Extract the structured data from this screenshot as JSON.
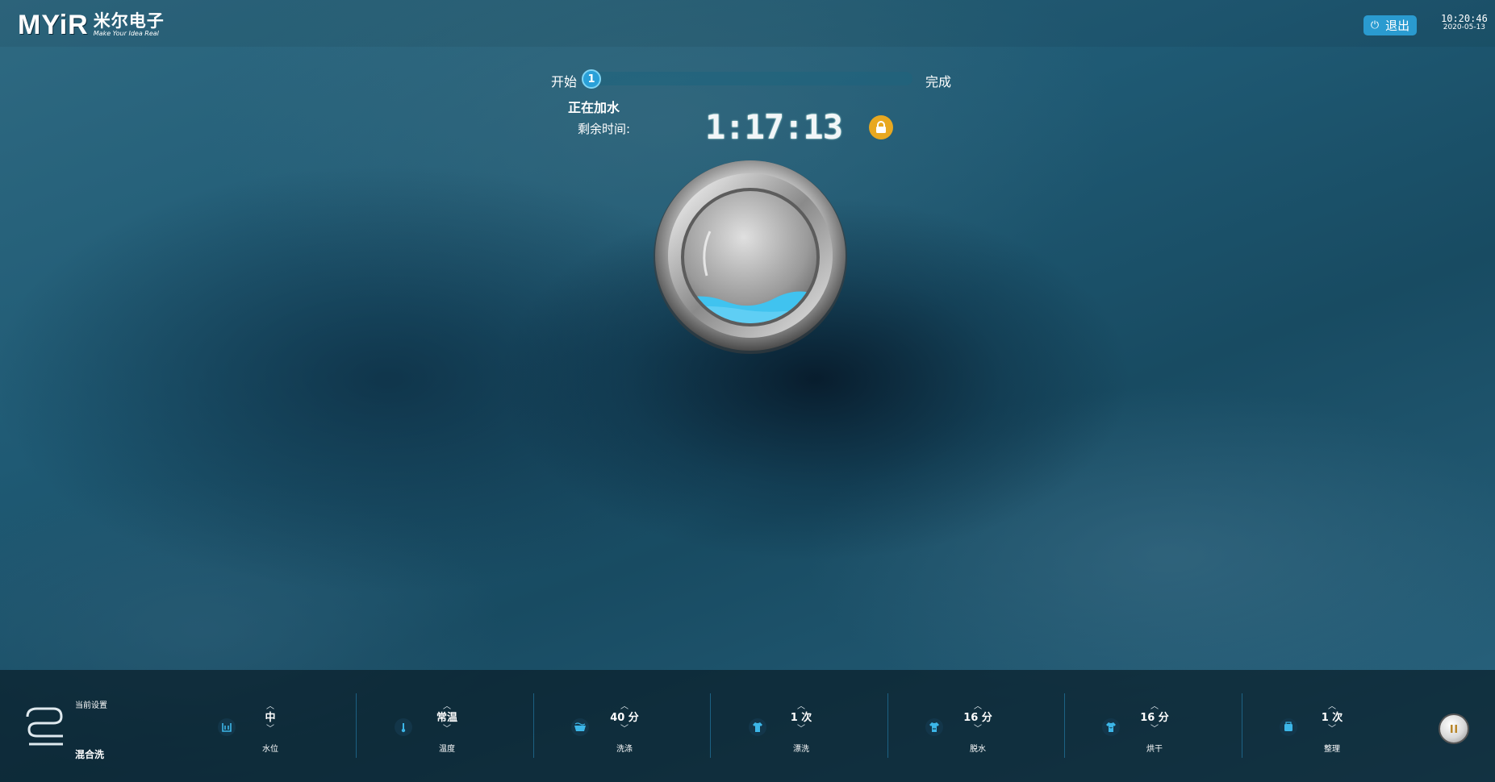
{
  "header": {
    "logo_mark": "MYiR",
    "logo_cn": "米尔电子",
    "logo_en": "Make Your Idea Real",
    "exit_label": "退出",
    "time": "10:20:46",
    "date": "2020-05-13"
  },
  "progress": {
    "start_label": "开始",
    "end_label": "完成",
    "current_step": "1",
    "status": "正在加水",
    "remaining_label": "剩余时间:",
    "remaining_time": "1:17:13",
    "percent": 0
  },
  "drum": {
    "water_level": "低"
  },
  "settings": {
    "title": "当前设置",
    "mode": "混合洗",
    "params": [
      {
        "value": "中",
        "label": "水位",
        "icon": "water-level-icon"
      },
      {
        "value": "常温",
        "label": "温度",
        "icon": "thermometer-icon"
      },
      {
        "value": "40 分",
        "label": "洗涤",
        "icon": "wash-tub-icon"
      },
      {
        "value": "1 次",
        "label": "漂洗",
        "icon": "rinse-shirt-icon"
      },
      {
        "value": "16 分",
        "label": "脱水",
        "icon": "spin-shirt-icon"
      },
      {
        "value": "16 分",
        "label": "烘干",
        "icon": "dry-shirt-icon"
      },
      {
        "value": "1 次",
        "label": "整理",
        "icon": "iron-icon"
      }
    ]
  },
  "colors": {
    "accent": "#2a9bd0",
    "lock": "#e8a820",
    "water": "#40c3ef"
  }
}
